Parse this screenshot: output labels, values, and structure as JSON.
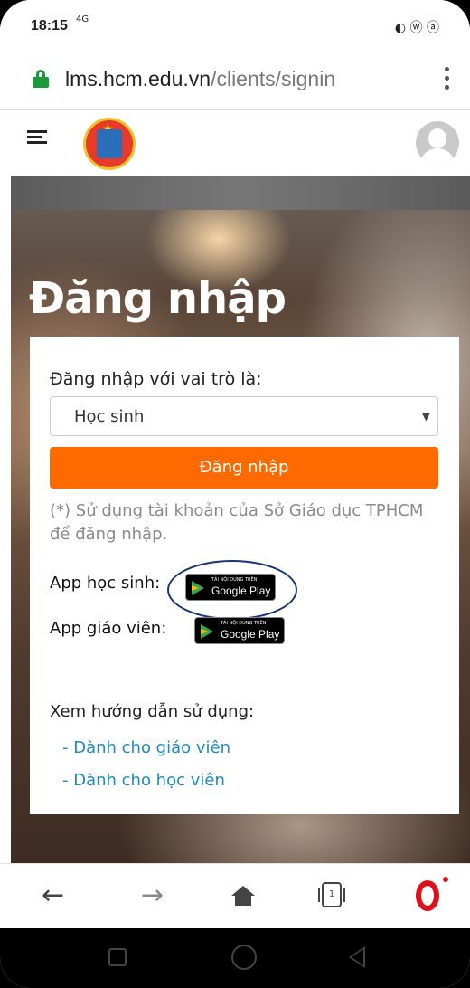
{
  "status_bar": {
    "time": "18:15",
    "network": "4G",
    "icons": "◐ ⓦ ⓐ"
  },
  "url_bar": {
    "domain": "lms.hcm.edu.vn",
    "path": "/clients/signin"
  },
  "hero": {
    "title": "Đăng nhập"
  },
  "login_card": {
    "role_label": "Đăng nhập với vai trò là:",
    "role_selected": "Học sinh",
    "login_button": "Đăng nhập",
    "note": "(*) Sử dụng tài khoản của Sở Giáo dục TPHCM để đăng nhập.",
    "student_app_label": "App học sinh:",
    "teacher_app_label": "App giáo viên:",
    "google_play_small": "TẢI NỘI DUNG TRÊN",
    "google_play_big": "Google Play",
    "guide_label": "Xem hướng dẫn sử dụng:",
    "guide_links": [
      "- Dành cho giáo viên",
      "- Dành cho học viên"
    ]
  },
  "bottom_bar": {
    "back": "←",
    "forward": "→",
    "tab_count": "1"
  },
  "colors": {
    "accent": "#ff6a00",
    "link": "#1f8ac0",
    "lock": "#1a9a3a",
    "opera": "#e0101a"
  }
}
